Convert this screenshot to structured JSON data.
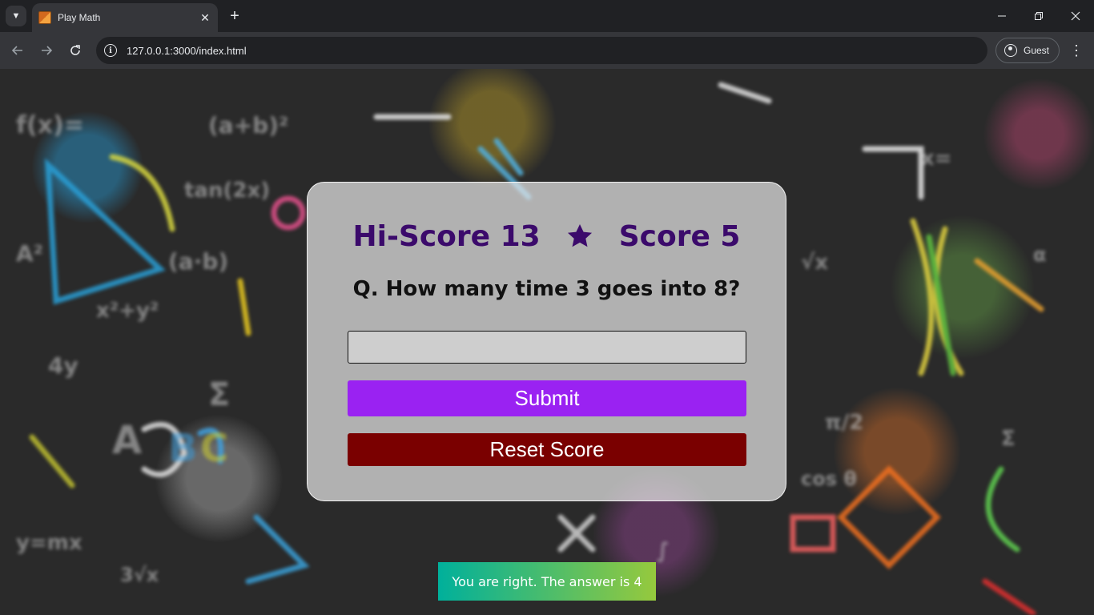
{
  "browser": {
    "tab_title": "Play Math",
    "url": "127.0.0.1:3000/index.html",
    "profile_label": "Guest",
    "icons": {
      "tab_list": "chevron-down-icon",
      "favicon": "abacus-icon",
      "close_tab": "close-icon",
      "new_tab": "plus-icon",
      "minimize": "minimize-icon",
      "restore": "restore-icon",
      "close_window": "close-icon",
      "back": "arrow-left-icon",
      "forward": "arrow-right-icon",
      "reload": "reload-icon",
      "site_info": "info-icon",
      "profile": "person-icon",
      "menu": "kebab-menu-icon"
    }
  },
  "game": {
    "hi_score_label": "Hi-Score 13",
    "score_label": "Score 5",
    "question": "Q. How many time 3 goes into 8?",
    "answer_value": "",
    "answer_placeholder": "",
    "submit_label": "Submit",
    "reset_label": "Reset Score",
    "star_icon": "star-icon",
    "colors": {
      "score_text": "#3b0a6b",
      "submit_bg": "#9a22f2",
      "reset_bg": "#7a0000"
    }
  },
  "toast": {
    "message": "You are right. The answer is 4",
    "colors": [
      "#00b09b",
      "#96c93d"
    ]
  }
}
